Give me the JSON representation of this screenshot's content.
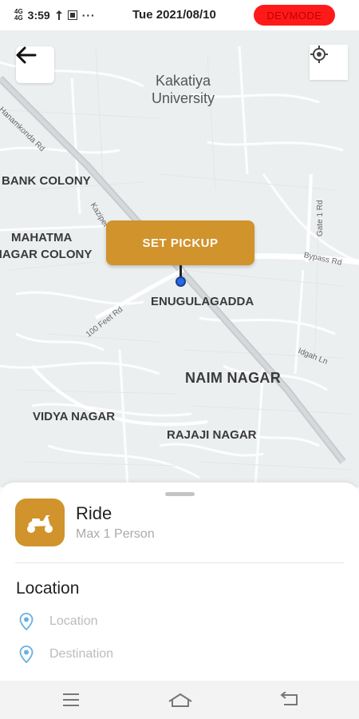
{
  "status_bar": {
    "network": "4G\n4G",
    "time": "3:59",
    "dots": "···",
    "date": "Tue 2021/08/10",
    "dev_badge": "DEVMODE"
  },
  "map": {
    "labels": {
      "university": "Kakatiya\nUniversity",
      "bank_colony": "BANK COLONY",
      "mahatma": "MAHATMA",
      "nagar_colony": "NAGAR COLONY",
      "enugulagadda": "ENUGULAGADDA",
      "naim_nagar": "NAIM NAGAR",
      "vidya_nagar": "VIDYA NAGAR",
      "rajaji_nagar": "RAJAJI NAGAR",
      "hanamkonda_rd": "Hanamkonda Rd",
      "kazipet": "Kazipet",
      "gate_rd": "Gate 1 Rd",
      "bypass_rd": "Bypass Rd",
      "feet_rd": "100 Feet Rd",
      "idgah_ln": "Idgah Ln"
    },
    "set_pickup_label": "SET PICKUP"
  },
  "ride": {
    "title": "Ride",
    "subtitle": "Max 1 Person",
    "icon": "scooter-icon"
  },
  "location": {
    "heading": "Location",
    "pickup_placeholder": "Location",
    "destination_placeholder": "Destination"
  },
  "colors": {
    "accent": "#d1932c",
    "dev_badge": "#ff1a1a",
    "pin_blue": "#2a6ae0"
  }
}
